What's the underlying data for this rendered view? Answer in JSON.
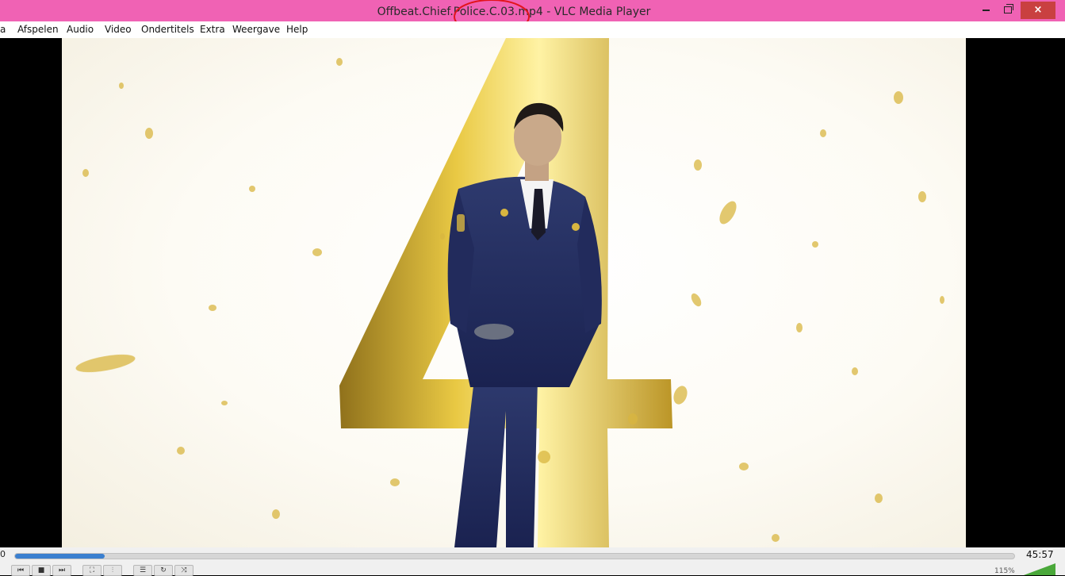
{
  "window": {
    "title": "Offbeat.Chief.Police.C.03.mp4 - VLC Media Player",
    "titlebar_color": "#f062b4",
    "controls": {
      "minimize": "minimize-icon",
      "maximize": "restore-icon",
      "close": "×"
    }
  },
  "menu": {
    "items": [
      "a",
      "Afspelen",
      "Audio",
      "Video",
      "Ondertitels",
      "Extra",
      "Weergave",
      "Help"
    ]
  },
  "player": {
    "elapsed": "0",
    "duration": "45:57",
    "progress_fraction": 0.09,
    "volume": "115%",
    "accent_color": "#3a7fcf",
    "buttons": [
      "previous-icon",
      "stop-icon",
      "next-icon",
      "fullscreen-icon",
      "equalizer-icon",
      "playlist-icon",
      "loop-icon",
      "shuffle-icon"
    ]
  }
}
